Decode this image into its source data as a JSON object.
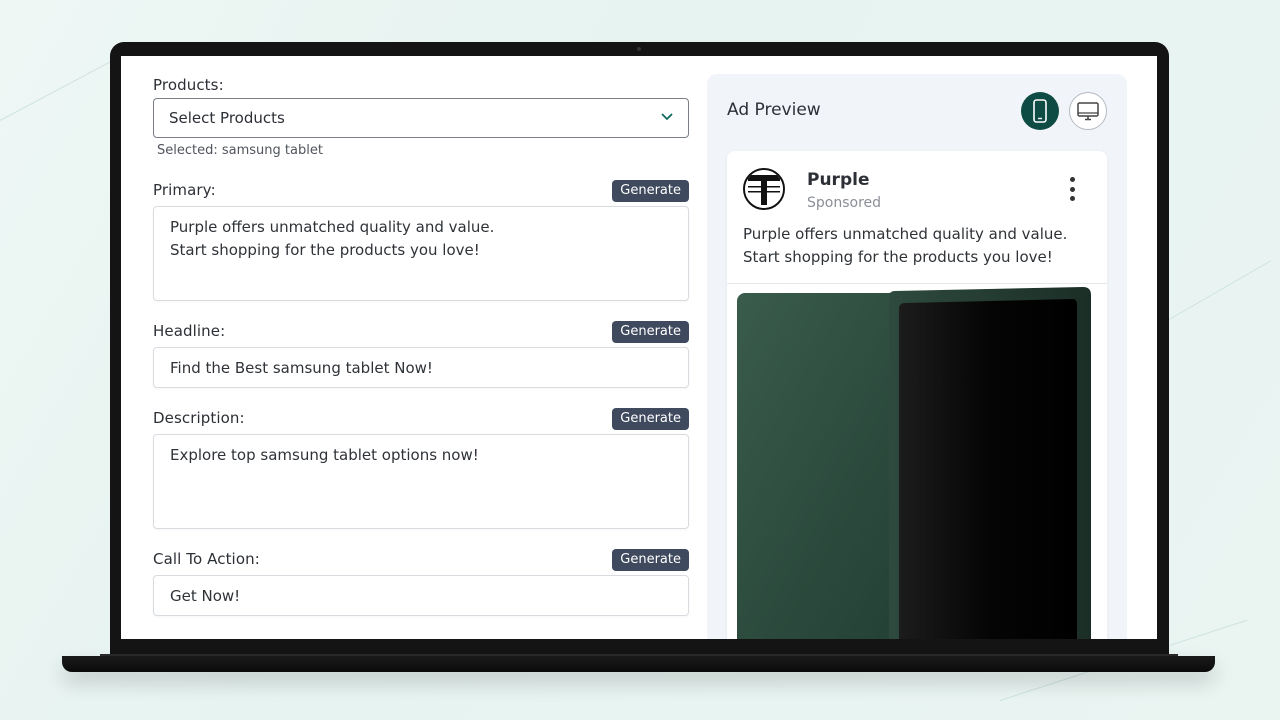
{
  "form": {
    "products_label": "Products:",
    "products_select_value": "Select Products",
    "selected_note": "Selected: samsung tablet",
    "primary_label": "Primary:",
    "primary_line1": "Purple offers unmatched quality and value.",
    "primary_line2": "Start shopping for the products you love!",
    "headline_label": "Headline:",
    "headline_value": "Find the Best samsung tablet Now!",
    "description_label": "Description:",
    "description_value": "Explore top samsung tablet options now!",
    "cta_label": "Call To Action:",
    "cta_value": "Get Now!",
    "generate_label": "Generate"
  },
  "preview": {
    "title": "Ad Preview",
    "brand_name": "Purple",
    "sponsored": "Sponsored",
    "text_line1": "Purple offers unmatched quality and value.",
    "text_line2": "Start shopping for the products you love!",
    "mobile_icon": "mobile-phone-icon",
    "desktop_icon": "desktop-monitor-icon"
  },
  "colors": {
    "generate_button": "#3f4a5e",
    "mobile_active": "#0f4b45",
    "panel_bg": "#f1f4f8",
    "tablet_green": "#2b4a3d"
  }
}
